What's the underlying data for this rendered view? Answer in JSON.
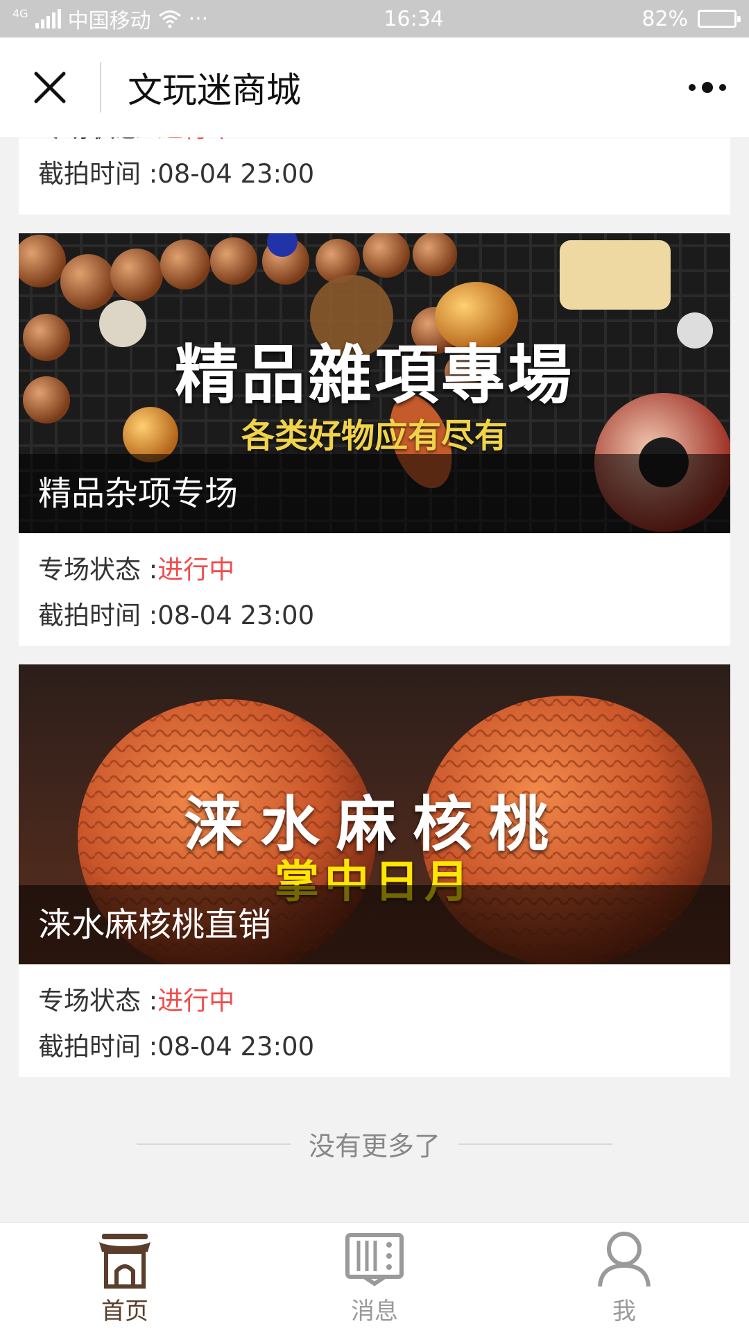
{
  "status_bar": {
    "network": "4G",
    "carrier": "中国移动",
    "more": "···",
    "time": "16:34",
    "battery_percent": "82%",
    "battery_level": 0.82
  },
  "nav": {
    "title": "文玩迷商城"
  },
  "labels": {
    "status_label": "专场状态 :",
    "time_label": "截拍时间 :"
  },
  "cards": [
    {
      "caption": "",
      "status": "进行中",
      "end_time": "08-04 23:00"
    },
    {
      "caption": "精品杂项专场",
      "banner_heading": "精品雜項專場",
      "banner_sub": "各类好物应有尽有",
      "status": "进行中",
      "end_time": "08-04 23:00"
    },
    {
      "caption": "涞水麻核桃直销",
      "banner_heading": "涞水麻核桃",
      "banner_sub": "掌中日月",
      "status": "进行中",
      "end_time": "08-04 23:00"
    }
  ],
  "footer_note": "没有更多了",
  "tabs": [
    {
      "label": "首页",
      "icon": "home-pavilion-icon",
      "active": true
    },
    {
      "label": "消息",
      "icon": "message-board-icon",
      "active": false
    },
    {
      "label": "我",
      "icon": "person-icon",
      "active": false
    }
  ],
  "colors": {
    "accent_status": "#f44b4b",
    "tab_active": "#5a3d2b",
    "tab_inactive": "#9a9a9a"
  }
}
